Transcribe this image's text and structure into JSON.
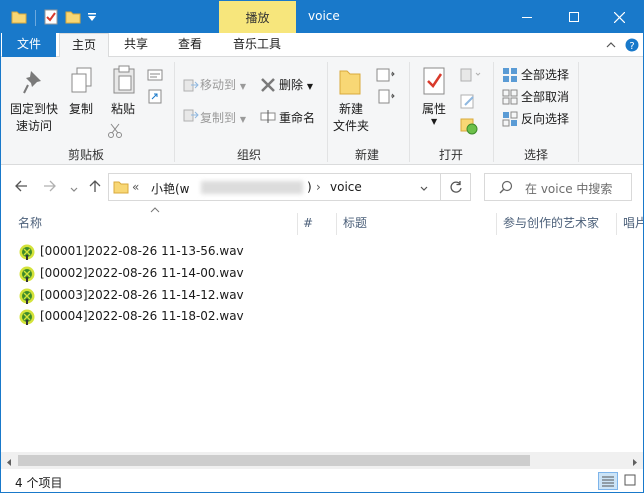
{
  "window": {
    "title": "voice",
    "context_tab": "播放",
    "controls": [
      "minimize-icon",
      "maximize-icon",
      "close-icon"
    ],
    "accent_color": "#1979ca",
    "context_color": "#f7e67c"
  },
  "tabs": [
    {
      "label": "文件"
    },
    {
      "label": "主页"
    },
    {
      "label": "共享"
    },
    {
      "label": "查看"
    },
    {
      "label": "音乐工具"
    }
  ],
  "ribbon": {
    "clipboard": {
      "pin": "固定到快\n速访问",
      "copy": "复制",
      "paste": "粘贴",
      "label": "剪贴板"
    },
    "organize": {
      "move_to": "移动到",
      "copy_to": "复制到",
      "delete": "删除",
      "rename": "重命名",
      "label": "组织"
    },
    "new": {
      "new_folder": "新建\n文件夹",
      "label": "新建"
    },
    "open": {
      "properties": "属性",
      "label": "打开"
    },
    "select": {
      "select_all": "全部选择",
      "select_none": "全部取消",
      "invert": "反向选择",
      "label": "选择"
    }
  },
  "address": {
    "chevron": "«",
    "parent": "小艳(w",
    "current": "voice",
    "separator": "›"
  },
  "search": {
    "placeholder": "在 voice 中搜索"
  },
  "columns": [
    "名称",
    "#",
    "标题",
    "参与创作的艺术家",
    "唱片"
  ],
  "files": [
    "[00001]2022-08-26 11-13-56.wav",
    "[00002]2022-08-26 11-14-00.wav",
    "[00003]2022-08-26 11-14-12.wav",
    "[00004]2022-08-26 11-18-02.wav"
  ],
  "status": {
    "count": "4 个项目"
  }
}
